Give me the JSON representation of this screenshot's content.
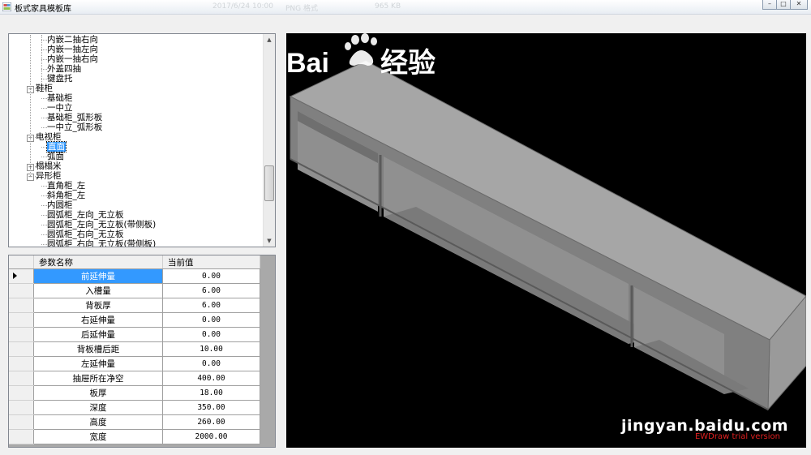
{
  "window": {
    "title": "板式家具模板库",
    "faded_texts": [
      "2017/6/24 10:00",
      "PNG 格式",
      "965 KB"
    ],
    "buttons": [
      "–",
      "□",
      "✕"
    ]
  },
  "tree": {
    "items": [
      {
        "label": "内嵌二抽右向",
        "level": 2
      },
      {
        "label": "内嵌一抽左向",
        "level": 2
      },
      {
        "label": "内嵌一抽右向",
        "level": 2
      },
      {
        "label": "外盖四抽",
        "level": 2
      },
      {
        "label": "键盘托",
        "level": 2
      },
      {
        "label": "鞋柜",
        "level": 1,
        "expander": "−"
      },
      {
        "label": "基础柜",
        "level": 2
      },
      {
        "label": "一中立",
        "level": 2
      },
      {
        "label": "基础柜_弧形板",
        "level": 2
      },
      {
        "label": "一中立_弧形板",
        "level": 2
      },
      {
        "label": "电视柜",
        "level": 1,
        "expander": "−"
      },
      {
        "label": "直面",
        "level": 2,
        "selected": true
      },
      {
        "label": "弧面",
        "level": 2
      },
      {
        "label": "榻榻米",
        "level": 1,
        "expander": "+"
      },
      {
        "label": "异形柜",
        "level": 1,
        "expander": "−"
      },
      {
        "label": "直角柜_左",
        "level": 2
      },
      {
        "label": "斜角柜_左",
        "level": 2
      },
      {
        "label": "内圆柜",
        "level": 2
      },
      {
        "label": "圆弧柜_左向_无立板",
        "level": 2
      },
      {
        "label": "圆弧柜_左向_无立板(带侧板)",
        "level": 2
      },
      {
        "label": "圆弧柜_右向_无立板",
        "level": 2
      },
      {
        "label": "圆弧柜_右向_无立板(带侧板)",
        "level": 2
      }
    ]
  },
  "grid": {
    "headers": [
      "参数名称",
      "当前值"
    ],
    "rows": [
      {
        "name": "前延伸量",
        "value": "0.00"
      },
      {
        "name": "入槽量",
        "value": "6.00"
      },
      {
        "name": "背板厚",
        "value": "6.00"
      },
      {
        "name": "右延伸量",
        "value": "0.00"
      },
      {
        "name": "后延伸量",
        "value": "0.00"
      },
      {
        "name": "背板槽后距",
        "value": "10.00"
      },
      {
        "name": "左延伸量",
        "value": "0.00"
      },
      {
        "name": "抽屉所在净空",
        "value": "400.00"
      },
      {
        "name": "板厚",
        "value": "18.00"
      },
      {
        "name": "深度",
        "value": "350.00"
      },
      {
        "name": "高度",
        "value": "260.00"
      },
      {
        "name": "宽度",
        "value": "2000.00"
      }
    ]
  },
  "viewport": {
    "background": "#000000",
    "model_top_color": "#a6a6a6",
    "model_front_color": "#8c8c8c",
    "model_side_color": "#9a9a9a",
    "watermark_text": "EWDraw trial version",
    "baidu_logo_text": "Baidu 经验",
    "baidu_url": "jingyan.baidu.com"
  }
}
